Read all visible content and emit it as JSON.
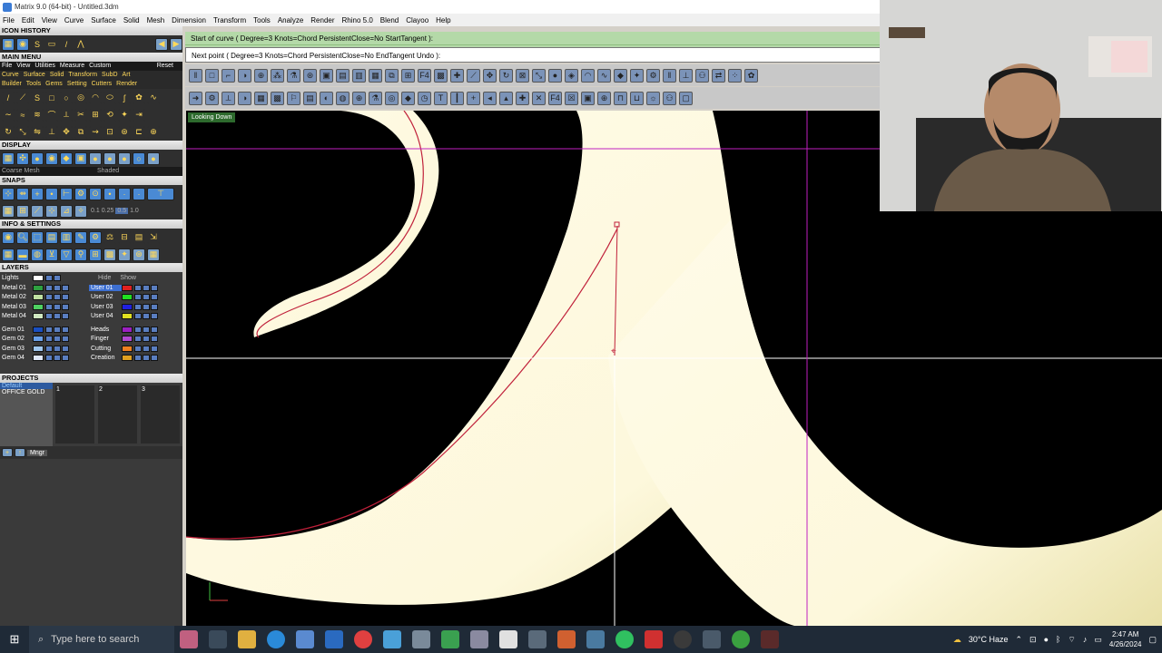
{
  "window": {
    "title": "Matrix 9.0 (64-bit) - Untitled.3dm"
  },
  "menu": [
    "File",
    "Edit",
    "View",
    "Curve",
    "Surface",
    "Solid",
    "Mesh",
    "Dimension",
    "Transform",
    "Tools",
    "Analyze",
    "Render",
    "Rhino 5.0",
    "Blend",
    "Clayoo",
    "Help"
  ],
  "panel": {
    "icon_history": "ICON HISTORY",
    "main_menu": "MAIN MENU",
    "main_menu_items": [
      "File",
      "View",
      "Utilities",
      "Measure",
      "Custom",
      "Reset"
    ],
    "submenu_a": [
      "Curve",
      "Surface",
      "Solid",
      "Transform",
      "SubD",
      "Art"
    ],
    "submenu_b": [
      "Builder",
      "Tools",
      "Gems",
      "Setting",
      "Cutters",
      "Render"
    ],
    "display": "DISPLAY",
    "display_modes": [
      "Coarse Mesh",
      "Shaded"
    ],
    "snaps": "SNAPS",
    "snap_values": [
      "0.1",
      "0.25",
      "0.5",
      "1.0"
    ],
    "info": "INFO & SETTINGS",
    "layers": "LAYERS",
    "lights": "Lights",
    "hide": "Hide",
    "show": "Show",
    "layers_left": [
      "Metal 01",
      "Metal 02",
      "Metal 03",
      "Metal 04",
      "Gem 01",
      "Gem 02",
      "Gem 03",
      "Gem 04"
    ],
    "layers_right": [
      "User 01",
      "User 02",
      "User 03",
      "User 04",
      "Heads",
      "Finger",
      "Cutting",
      "Creation"
    ],
    "projects": "PROJECTS",
    "project_items": [
      "Default",
      "OFFICE GOLD"
    ],
    "project_slots": [
      "1",
      "2",
      "3"
    ],
    "mngr": "Mngr"
  },
  "command": {
    "history": "Start of curve ( Degree=3  Knots=Chord  PersistentClose=No  StartTangent ):",
    "prompt": "Next point ( Degree=3  Knots=Chord  PersistentClose=No  EndTangent  Undo ):"
  },
  "viewport": {
    "label": "Looking Down"
  },
  "taskbar": {
    "search": "Type here to search",
    "weather": "30°C  Haze",
    "time": "2:47 AM",
    "date": "4/26/2024"
  },
  "colors": {
    "cmd_bg": "#b4d9a8",
    "shape_fill": "#fdfbe8",
    "curve": "#c0203a",
    "guide_v": "#c020c0"
  }
}
